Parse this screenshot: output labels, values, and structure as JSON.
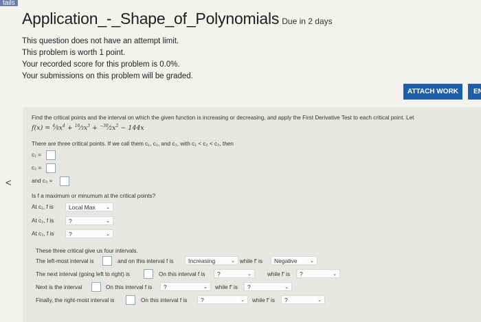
{
  "crop_label": "tails",
  "header": {
    "title": "Application_-_Shape_of_Polynomials",
    "due": "Due in 2 days"
  },
  "info": [
    "This question does not have an attempt limit.",
    "This problem is worth 1 point.",
    "Your recorded score for this problem is 0.0%.",
    "Your submissions on this problem will be graded."
  ],
  "buttons": {
    "attach": "ATTACH WORK",
    "attach2": "EN"
  },
  "nav": {
    "back": "<"
  },
  "problem": {
    "prompt": "Find the critical points and the interval on which the given function is increasing or decreasing, and apply the First Derivative Test to each critical point. Let",
    "equation_lhs": "f(x) =",
    "equation_rest": "− 144x",
    "there_are": "There are three critical points. If we call them c₁, c₂, and c₃, with c₁ < c₂ < c₃, then",
    "c1": "c₁ =",
    "c2": "c₂ =",
    "c3_and": "and c₃ =",
    "is_max_min": "Is f a maximum or minumum at the critical points?",
    "at_c1": "At c₁, f is",
    "at_c2": "At c₂, f is",
    "at_c3": "At c₃, f is",
    "sel_c1": "Local Max",
    "sel_c2": "?",
    "sel_c3": "?",
    "intervals_intro": "These three critical give us four intervals.",
    "leftmost": "The left-most interval is",
    "and_on_this": "and on this interval f is",
    "while_fp": "while f′ is",
    "next_left_right": "The next interval (going left to right) is",
    "on_this_interval": "On this interval f is",
    "next_is": "Next is the interval",
    "finally": "Finally, the right-most interval is",
    "sel_r1_a": "Increasing",
    "sel_r1_b": "Negative",
    "q": "?"
  }
}
